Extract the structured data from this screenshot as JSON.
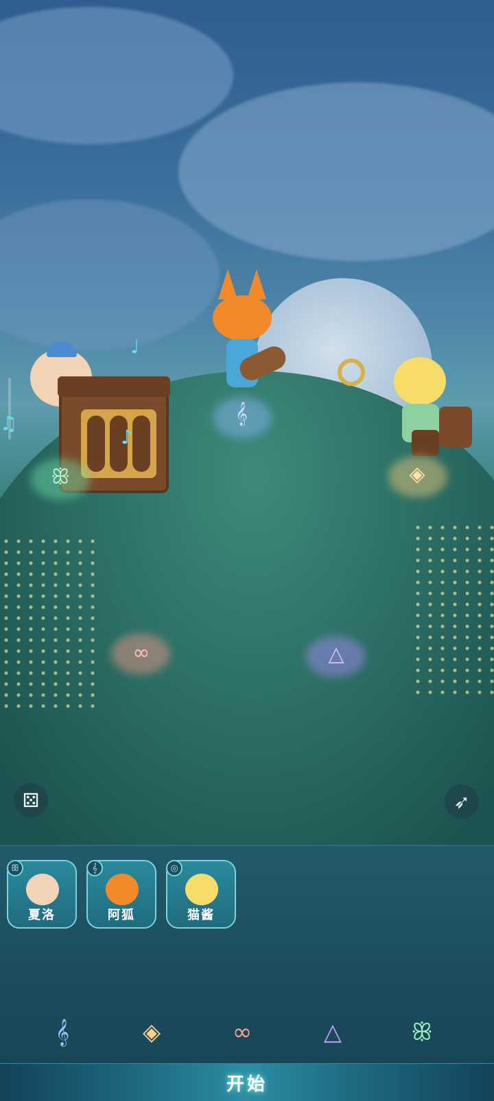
{
  "scene": {
    "instruments": {
      "left_symbol": "ꕥ",
      "center_symbol": "𝄞",
      "right_symbol": "◈",
      "slot_left_symbol": "∞",
      "slot_right_symbol": "△"
    },
    "notes": [
      "♪",
      "♫",
      "♩"
    ],
    "tools": {
      "dice_icon": "⚄",
      "run_icon": "➶"
    },
    "colors": {
      "left_glow": "#6ee0a8",
      "center_glow": "#8fb8ff",
      "right_glow": "#ffcf7a",
      "slot_left_glow": "#ff9a8a",
      "slot_right_glow": "#b28bff"
    }
  },
  "roster": [
    {
      "name": "夏洛",
      "badge": "ꕥ",
      "face_color": "#f2d3b6"
    },
    {
      "name": "阿狐",
      "badge": "𝄞",
      "face_color": "#f28a2a"
    },
    {
      "name": "猫酱",
      "badge": "◎",
      "face_color": "#f7dc6a"
    }
  ],
  "instrument_types": [
    {
      "symbol": "𝄞",
      "color": "#9fc6ff"
    },
    {
      "symbol": "◈",
      "color": "#ffcf8a"
    },
    {
      "symbol": "∞",
      "color": "#ff9f93"
    },
    {
      "symbol": "△",
      "color": "#c49bff"
    },
    {
      "symbol": "ꕥ",
      "color": "#9ef0c4"
    }
  ],
  "start_label": "开始"
}
